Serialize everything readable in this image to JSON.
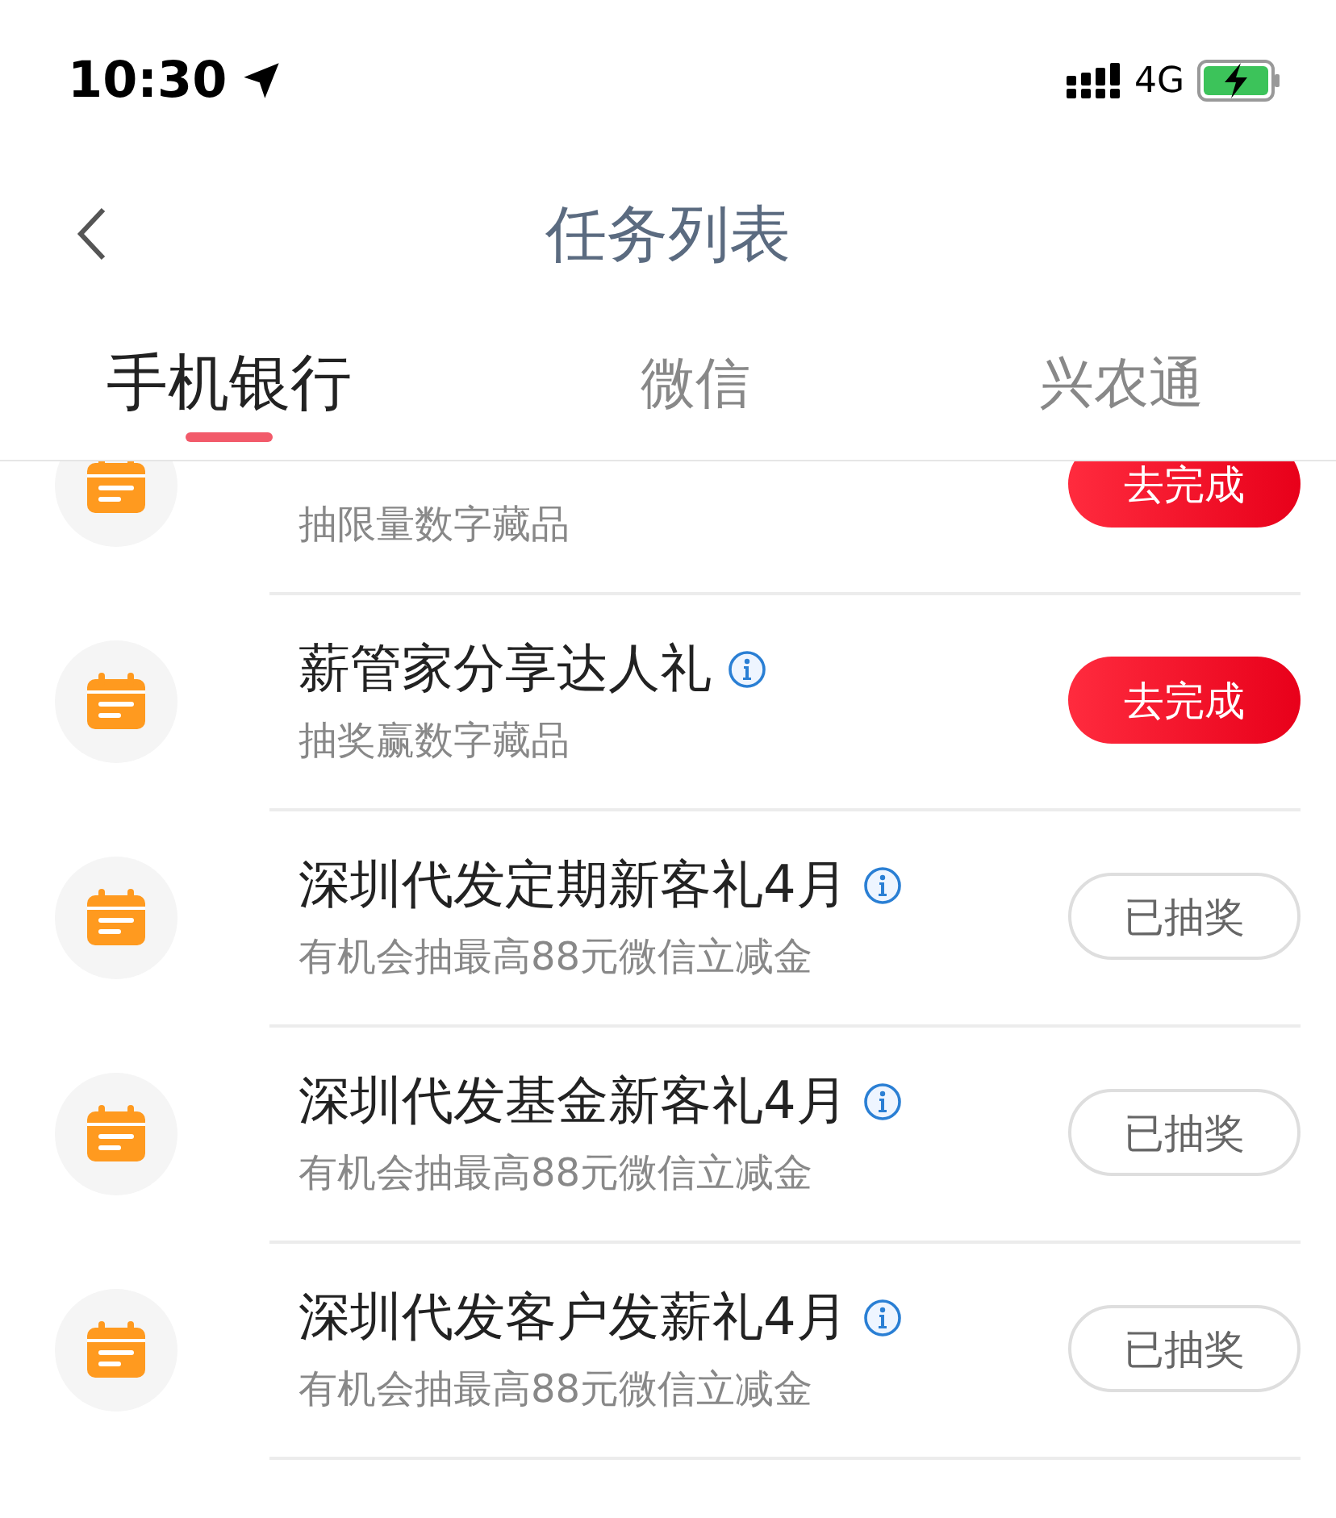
{
  "status_bar": {
    "time": "10:30",
    "network": "4G"
  },
  "nav": {
    "title": "任务列表"
  },
  "tabs": [
    {
      "label": "手机银行",
      "selected": true
    },
    {
      "label": "微信",
      "selected": false
    },
    {
      "label": "兴农通",
      "selected": false
    }
  ],
  "tasks": [
    {
      "subtitle": "抽限量数字藏品",
      "button": "去完成",
      "completed": false
    },
    {
      "title": "薪管家分享达人礼",
      "subtitle": "抽奖赢数字藏品",
      "button": "去完成",
      "completed": false
    },
    {
      "title": "深圳代发定期新客礼4月",
      "subtitle": "有机会抽最高88元微信立减金",
      "button": "已抽奖",
      "completed": true
    },
    {
      "title": "深圳代发基金新客礼4月",
      "subtitle": "有机会抽最高88元微信立减金",
      "button": "已抽奖",
      "completed": true
    },
    {
      "title": "深圳代发客户发薪礼4月",
      "subtitle": "有机会抽最高88元微信立减金",
      "button": "已抽奖",
      "completed": true
    }
  ]
}
